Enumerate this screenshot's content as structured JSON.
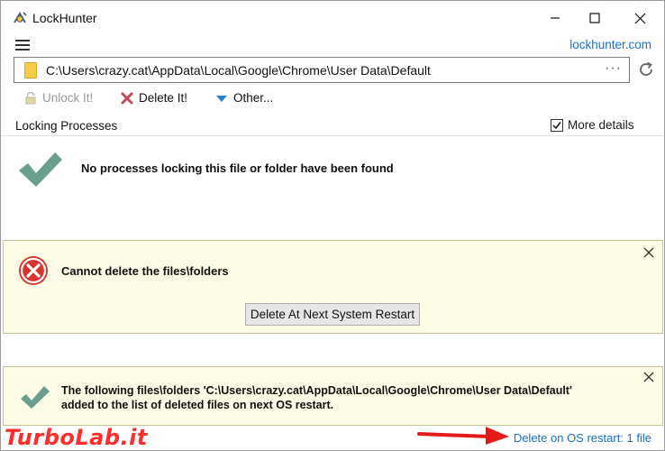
{
  "window": {
    "title": "LockHunter",
    "site_link": "lockhunter.com"
  },
  "path": {
    "value": "C:\\Users\\crazy.cat\\AppData\\Local\\Google\\Chrome\\User Data\\Default",
    "browse_label": "···"
  },
  "toolbar": {
    "unlock_label": "Unlock It!",
    "delete_label": "Delete It!",
    "other_label": "Other..."
  },
  "locking": {
    "section_label": "Locking Processes",
    "more_details_label": "More details",
    "more_details_checked": true,
    "no_processes_text": "No processes locking this file or folder have been found"
  },
  "error_panel": {
    "message": "Cannot delete the files\\folders",
    "button_label": "Delete At Next System Restart"
  },
  "success_panel": {
    "line1": "The following files\\folders 'C:\\Users\\crazy.cat\\AppData\\Local\\Google\\Chrome\\User Data\\Default'",
    "line2": "added to the list of deleted files on next OS restart."
  },
  "status": {
    "restart_link": "Delete on OS restart: 1 file"
  },
  "watermark": "TurboLab.it",
  "icons": {
    "app": "lockhunter-icon",
    "folder": "folder-icon",
    "refresh": "refresh-icon",
    "unlock": "lock-icon",
    "delete": "delete-x-icon",
    "other": "triangle-down-icon",
    "success": "checkmark-icon",
    "error": "error-x-icon",
    "close": "close-icon"
  },
  "colors": {
    "link": "#1a6fc9",
    "panel_bg": "#fcfbe6",
    "check": "#6a9e8e",
    "error": "#d9342b",
    "arrow": "#e31b1b"
  }
}
